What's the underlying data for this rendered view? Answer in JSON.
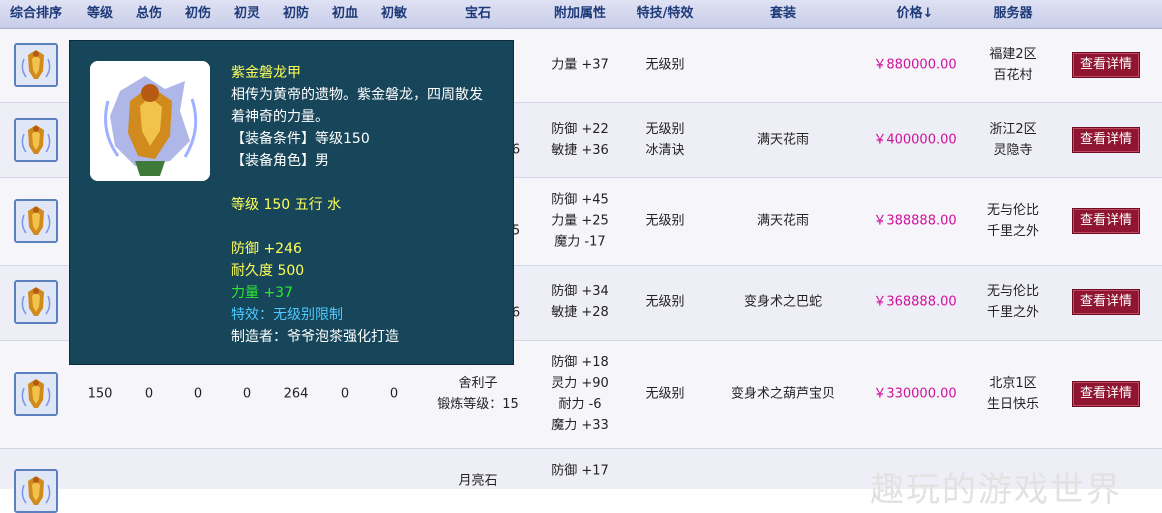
{
  "columns": {
    "sort": "综合排序",
    "level": "等级",
    "total_damage": "总伤",
    "base_damage": "初伤",
    "base_spirit": "初灵",
    "base_defense": "初防",
    "base_hp": "初血",
    "base_agility": "初敏",
    "gem": "宝石",
    "attrs": "附加属性",
    "skill": "特技/特效",
    "set": "套装",
    "price": "价格↓",
    "server": "服务器"
  },
  "rows": [
    {
      "gem1": "",
      "gem2": "",
      "attrs": [
        "力量 +37"
      ],
      "skill": [
        "无级别"
      ],
      "set": "",
      "price": "￥880000.00",
      "server": [
        "福建2区",
        "百花村"
      ],
      "button": "查看详情"
    },
    {
      "gem_partial": "6",
      "attrs": [
        "防御 +22",
        "敏捷 +36"
      ],
      "skill": [
        "无级别",
        "冰清诀"
      ],
      "set": "满天花雨",
      "price": "￥400000.00",
      "server": [
        "浙江2区",
        "灵隐寺"
      ],
      "button": "查看详情"
    },
    {
      "gem_partial": "5",
      "attrs": [
        "防御 +45",
        "力量 +25",
        "魔力 -17"
      ],
      "skill": [
        "无级别"
      ],
      "set": "满天花雨",
      "price": "￥388888.00",
      "server": [
        "无与伦比",
        "千里之外"
      ],
      "button": "查看详情"
    },
    {
      "gem_partial": "6",
      "attrs": [
        "防御 +34",
        "敏捷 +28"
      ],
      "skill": [
        "无级别"
      ],
      "set": "变身术之巴蛇",
      "price": "￥368888.00",
      "server": [
        "无与伦比",
        "千里之外"
      ],
      "button": "查看详情"
    },
    {
      "level": "150",
      "total_damage": "0",
      "base_damage": "0",
      "base_spirit": "0",
      "base_defense": "264",
      "base_hp": "0",
      "base_agility": "0",
      "gem1": "舍利子",
      "gem2": "锻炼等级：15",
      "attrs": [
        "防御 +18",
        "灵力 +90",
        "耐力 -6",
        "魔力 +33"
      ],
      "skill": [
        "无级别"
      ],
      "set": "变身术之葫芦宝贝",
      "price": "￥330000.00",
      "server": [
        "北京1区",
        "生日快乐"
      ],
      "button": "查看详情"
    },
    {
      "gem1": "月亮石",
      "attrs": [
        "防御 +17"
      ]
    }
  ],
  "tooltip": {
    "name": "紫金磐龙甲",
    "desc1": "相传为黄帝的遗物。紫金磐龙，四周散发",
    "desc2": "着神奇的力量。",
    "req_level": "【装备条件】等级150",
    "req_role": "【装备角色】男",
    "level_element": "等级 150 五行 水",
    "defense": "防御 +246",
    "durability": "耐久度 500",
    "strength": "力量 +37",
    "effect": "特效：无级别限制",
    "maker": "制造者：爷爷泡茶强化打造"
  },
  "watermark": "趣玩的游戏世界",
  "colors": {
    "header_text": "#1e3a78",
    "price": "#d0109a",
    "button_bg": "#8f1530",
    "tooltip_bg": "#17465b",
    "tooltip_yellow": "#ffff57",
    "tooltip_green": "#2ee82e",
    "tooltip_cyan": "#4cc9ff"
  }
}
